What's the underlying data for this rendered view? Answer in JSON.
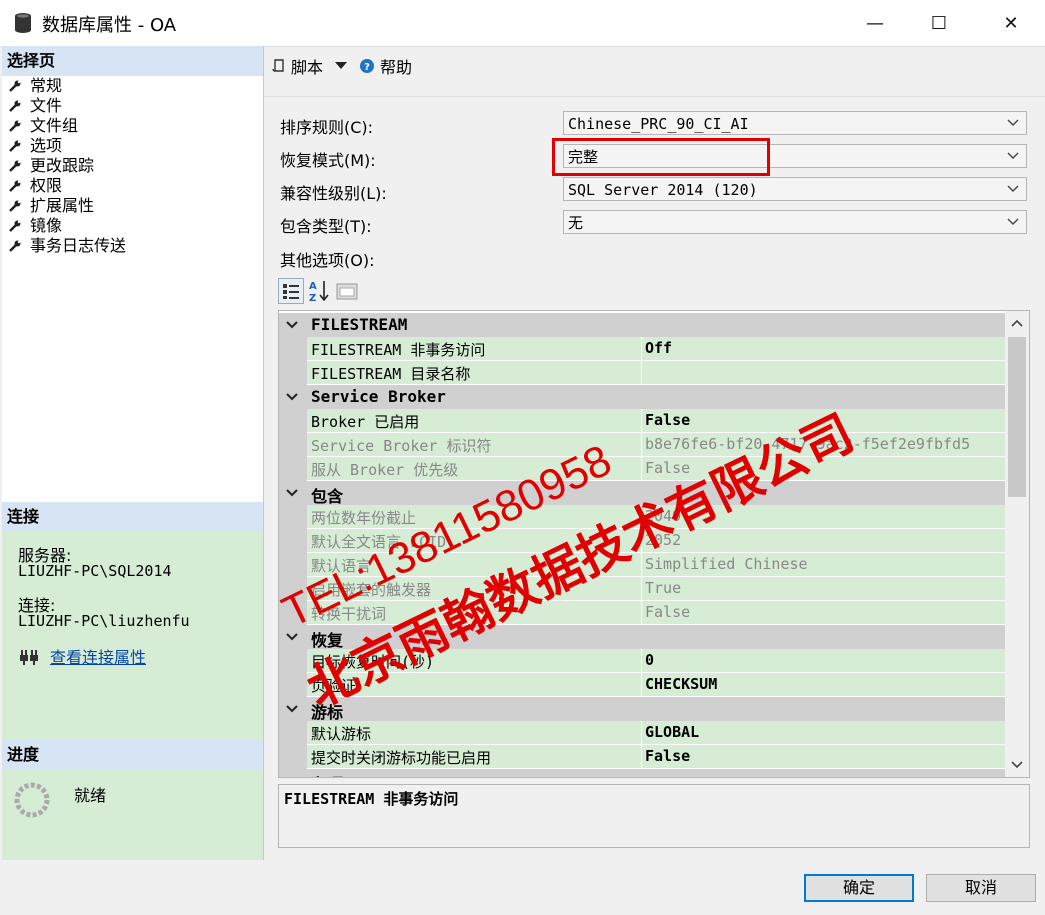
{
  "window": {
    "title": "数据库属性 - OA",
    "min_glyph": "—",
    "max_glyph": "☐",
    "close_glyph": "✕"
  },
  "left": {
    "select_page_header": "选择页",
    "pages": [
      "常规",
      "文件",
      "文件组",
      "选项",
      "更改跟踪",
      "权限",
      "扩展属性",
      "镜像",
      "事务日志传送"
    ],
    "connection_header": "连接",
    "server_label": "服务器:",
    "server_value": "LIUZHF-PC\\SQL2014",
    "connection_label": "连接:",
    "connection_value": "LIUZHF-PC\\liuzhenfu",
    "view_conn_props": "查看连接属性",
    "progress_header": "进度",
    "progress_status": "就绪"
  },
  "toolbar": {
    "script_label": "脚本",
    "help_label": "帮助"
  },
  "form": {
    "collation_label": "排序规则(C):",
    "collation_value": "Chinese_PRC_90_CI_AI",
    "recovery_label": "恢复模式(M):",
    "recovery_value": "完整",
    "compat_label": "兼容性级别(L):",
    "compat_value": "SQL Server 2014 (120)",
    "containment_label": "包含类型(T):",
    "containment_value": "无",
    "other_label": "其他选项(O):"
  },
  "grid": {
    "rows": [
      {
        "kind": "cat",
        "text": "FILESTREAM"
      },
      {
        "kind": "prop",
        "name": "FILESTREAM 非事务访问",
        "value": "Off",
        "style": "bold"
      },
      {
        "kind": "prop",
        "name": "FILESTREAM 目录名称",
        "value": "",
        "style": ""
      },
      {
        "kind": "cat",
        "text": "Service Broker"
      },
      {
        "kind": "prop",
        "name": "Broker 已启用",
        "value": "False",
        "style": "bold"
      },
      {
        "kind": "prop",
        "name": "Service Broker 标识符",
        "value": "b8e76fe6-bf20-4717-9ac2-f5ef2e9fbfd5",
        "style": "ro"
      },
      {
        "kind": "prop",
        "name": "服从 Broker 优先级",
        "value": "False",
        "style": "ro"
      },
      {
        "kind": "cat",
        "text": "包含"
      },
      {
        "kind": "prop",
        "name": "两位数年份截止",
        "value": "2049",
        "style": "ro"
      },
      {
        "kind": "prop",
        "name": "默认全文语言 LCID",
        "value": "2052",
        "style": "ro"
      },
      {
        "kind": "prop",
        "name": "默认语言",
        "value": "Simplified Chinese",
        "style": "ro"
      },
      {
        "kind": "prop",
        "name": "启用嵌套的触发器",
        "value": "True",
        "style": "ro"
      },
      {
        "kind": "prop",
        "name": "转换干扰词",
        "value": "False",
        "style": "ro"
      },
      {
        "kind": "cat",
        "text": "恢复"
      },
      {
        "kind": "prop",
        "name": "目标恢复时间(秒)",
        "value": "0",
        "style": "bold"
      },
      {
        "kind": "prop",
        "name": "页验证",
        "value": "CHECKSUM",
        "style": "bold"
      },
      {
        "kind": "cat",
        "text": "游标"
      },
      {
        "kind": "prop",
        "name": "默认游标",
        "value": "GLOBAL",
        "style": "bold"
      },
      {
        "kind": "prop",
        "name": "提交时关闭游标功能已启用",
        "value": "False",
        "style": "bold"
      },
      {
        "kind": "cat",
        "text": "杂项"
      }
    ]
  },
  "description": "FILESTREAM 非事务访问",
  "buttons": {
    "ok": "确定",
    "cancel": "取消"
  },
  "watermark": {
    "phone": "TEL:13811580958",
    "company": "北京雨翰数据技术有限公司",
    "color": "#e00000"
  }
}
